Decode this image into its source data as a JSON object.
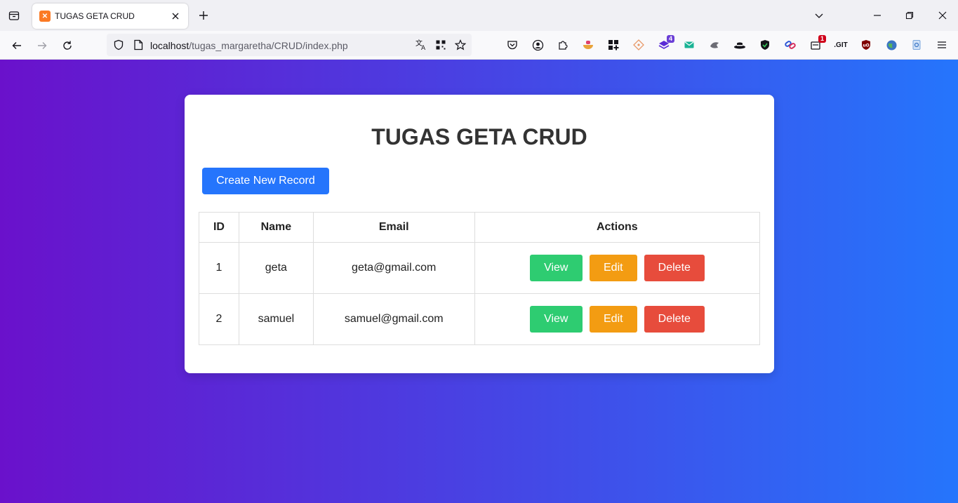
{
  "browser": {
    "tab_title": "TUGAS GETA CRUD",
    "url_host": "localhost",
    "url_path": "/tugas_margaretha/CRUD/index.php",
    "extension_badges": {
      "purple": "4",
      "red": "1"
    },
    "git_label": ".GIT"
  },
  "page": {
    "title": "TUGAS GETA CRUD",
    "create_button": "Create New Record",
    "gradient_colors": [
      "#6a11cb",
      "#2575fc"
    ]
  },
  "table": {
    "headers": {
      "id": "ID",
      "name": "Name",
      "email": "Email",
      "actions": "Actions"
    },
    "rows": [
      {
        "id": "1",
        "name": "geta",
        "email": "geta@gmail.com"
      },
      {
        "id": "2",
        "name": "samuel",
        "email": "samuel@gmail.com"
      }
    ],
    "actions": {
      "view": "View",
      "edit": "Edit",
      "delete": "Delete"
    }
  }
}
